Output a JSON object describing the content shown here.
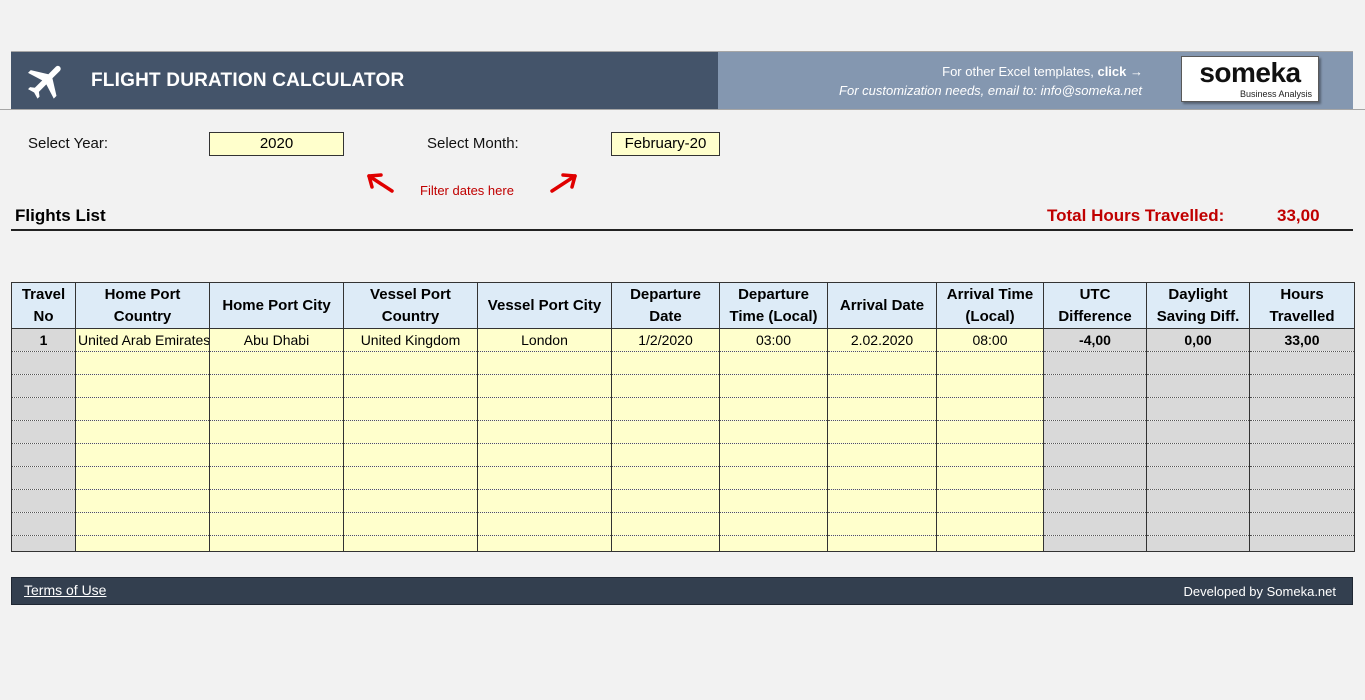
{
  "header": {
    "title": "FLIGHT DURATION CALCULATOR",
    "promo_line1_prefix": "For other Excel templates, ",
    "promo_line1_link": "click →",
    "promo_line2": "For customization needs, email to: info@someka.net",
    "logo_word": "someka",
    "logo_sub": "Business Analysis",
    "icon": "airplane-icon"
  },
  "filters": {
    "year_label": "Select Year:",
    "year_value": "2020",
    "month_label": "Select Month:",
    "month_value": "February-20",
    "hint": "Filter dates here"
  },
  "section": {
    "title": "Flights List",
    "total_label": "Total Hours Travelled:",
    "total_value": "33,00"
  },
  "table": {
    "columns": [
      {
        "line1": "Travel",
        "line2": "No"
      },
      {
        "line1": "Home Port",
        "line2": "Country"
      },
      {
        "line1": "Home Port City",
        "line2": ""
      },
      {
        "line1": "Vessel Port",
        "line2": "Country"
      },
      {
        "line1": "Vessel Port City",
        "line2": ""
      },
      {
        "line1": "Departure",
        "line2": "Date"
      },
      {
        "line1": "Departure",
        "line2": "Time (Local)"
      },
      {
        "line1": "Arrival Date",
        "line2": ""
      },
      {
        "line1": "Arrival Time",
        "line2": "(Local)"
      },
      {
        "line1": "UTC",
        "line2": "Difference"
      },
      {
        "line1": "Daylight",
        "line2": "Saving Diff."
      },
      {
        "line1": "Hours",
        "line2": "Travelled"
      }
    ],
    "rows": [
      [
        "1",
        "United Arab Emirates",
        "Abu Dhabi",
        "United Kingdom",
        "London",
        "1/2/2020",
        "03:00",
        "2.02.2020",
        "08:00",
        "-4,00",
        "0,00",
        "33,00"
      ]
    ]
  },
  "footer": {
    "terms": "Terms of Use",
    "developed": "Developed by Someka.net"
  },
  "colors": {
    "header_dark": "#44546a",
    "header_light": "#8497b0",
    "input_fill": "#ffffcc",
    "calc_fill": "#d9d9d9",
    "header_row_fill": "#ddebf7",
    "accent_red": "#c00000",
    "footer_fill": "#333f4f"
  }
}
